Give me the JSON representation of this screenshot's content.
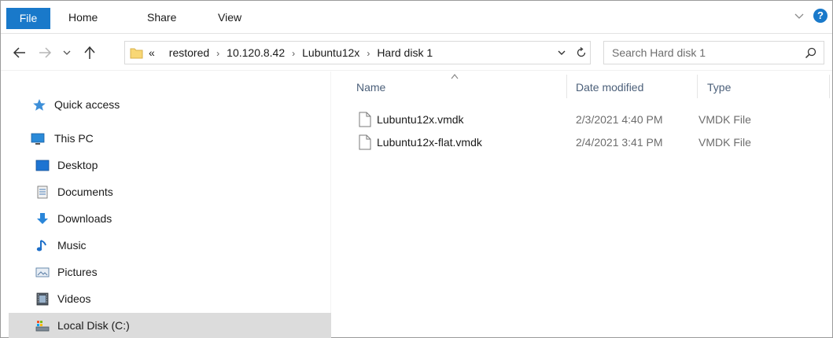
{
  "ribbon": {
    "tabs": [
      {
        "label": "File"
      },
      {
        "label": "Home"
      },
      {
        "label": "Share"
      },
      {
        "label": "View"
      }
    ],
    "help_label": "?"
  },
  "address_bar": {
    "overflow": "«",
    "crumbs": [
      "restored",
      "10.120.8.42",
      "Lubuntu12x",
      "Hard disk 1"
    ]
  },
  "search": {
    "placeholder": "Search Hard disk 1"
  },
  "nav_pane": {
    "items": [
      {
        "label": "Quick access",
        "icon": "star-icon"
      },
      {
        "label": "This PC",
        "icon": "computer-icon"
      },
      {
        "label": "Desktop",
        "icon": "desktop-icon"
      },
      {
        "label": "Documents",
        "icon": "documents-icon"
      },
      {
        "label": "Downloads",
        "icon": "downloads-icon"
      },
      {
        "label": "Music",
        "icon": "music-icon"
      },
      {
        "label": "Pictures",
        "icon": "pictures-icon"
      },
      {
        "label": "Videos",
        "icon": "videos-icon"
      },
      {
        "label": "Local Disk (C:)",
        "icon": "drive-icon",
        "selected": true
      }
    ]
  },
  "file_list": {
    "columns": {
      "name": "Name",
      "date": "Date modified",
      "type": "Type"
    },
    "rows": [
      {
        "name": "Lubuntu12x.vmdk",
        "date": "2/3/2021 4:40 PM",
        "type": "VMDK File"
      },
      {
        "name": "Lubuntu12x-flat.vmdk",
        "date": "2/4/2021 3:41 PM",
        "type": "VMDK File"
      }
    ]
  },
  "colors": {
    "accent": "#1979ca",
    "selected_bg": "#dcdcdc",
    "header_text": "#4c607a"
  }
}
